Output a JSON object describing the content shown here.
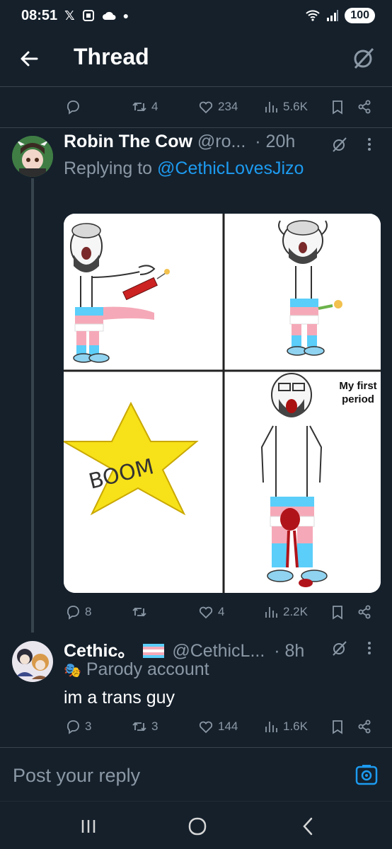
{
  "status_bar": {
    "time": "08:51",
    "battery": "100"
  },
  "header": {
    "title": "Thread"
  },
  "prev_actions": {
    "replies": "",
    "reposts": "4",
    "likes": "234",
    "views": "5.6K"
  },
  "tweet1": {
    "name": "Robin The Cow",
    "handle": "@ro...",
    "time": "· 20h",
    "replying_prefix": "Replying to ",
    "replying_to": "@CethicLovesJizo",
    "meme_caption": "My first period",
    "meme_boom": "BOOM",
    "actions": {
      "replies": "8",
      "reposts": "",
      "likes": "4",
      "views": "2.2K"
    }
  },
  "tweet2": {
    "name": "Cethic。",
    "handle": "@CethicL...",
    "time": "· 8h",
    "label": "Parody account",
    "text": "im a trans guy",
    "actions": {
      "replies": "3",
      "reposts": "3",
      "likes": "144",
      "views": "1.6K"
    }
  },
  "reply_bar": {
    "placeholder": "Post your reply"
  },
  "colors": {
    "bg": "#15202b",
    "accent": "#1d9bf0",
    "muted": "#8b98a5",
    "divider": "#38444d"
  }
}
